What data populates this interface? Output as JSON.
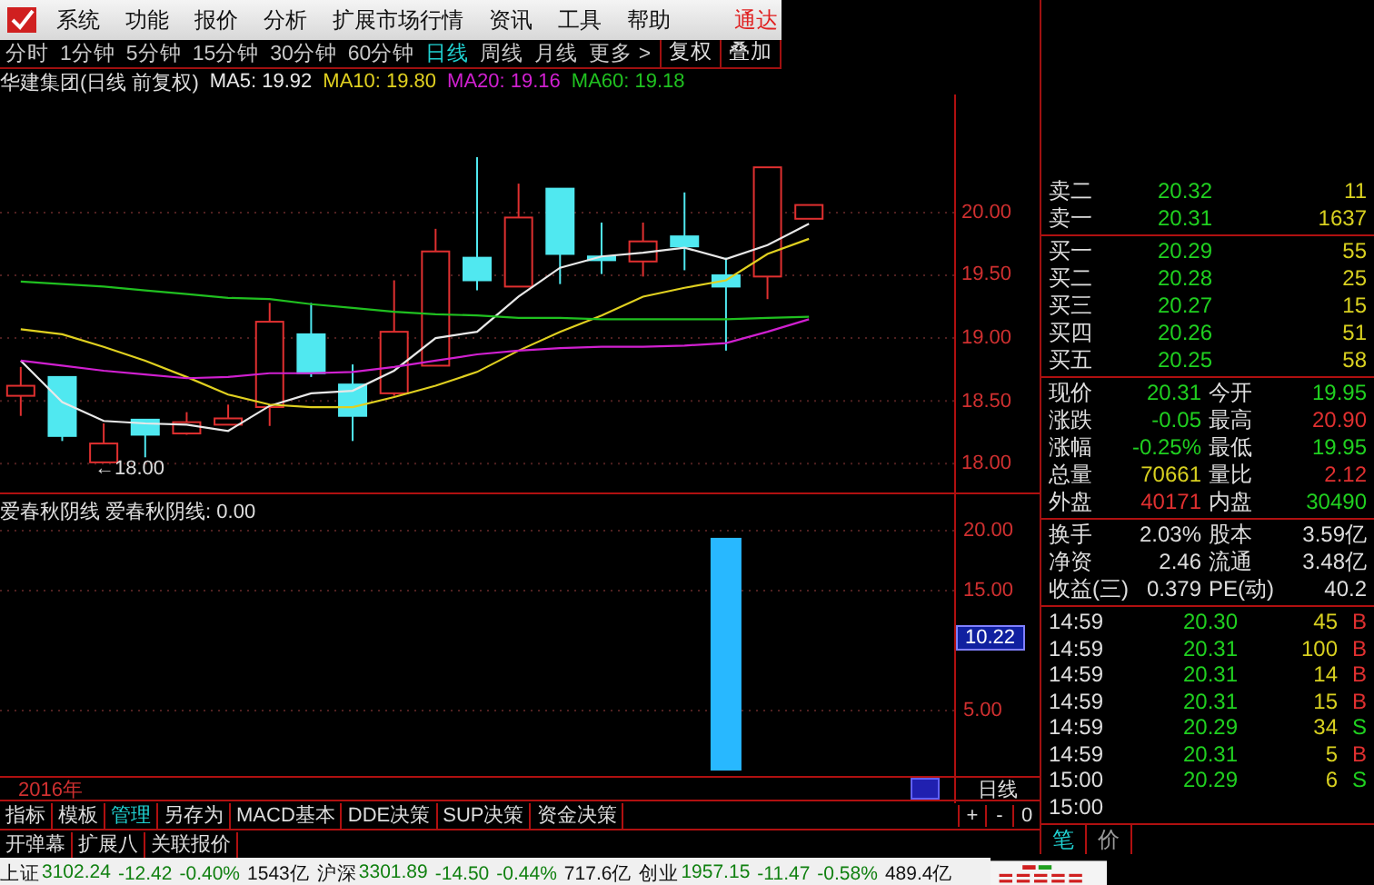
{
  "menu": {
    "items": [
      {
        "label": "系统"
      },
      {
        "label": "功能"
      },
      {
        "label": "报价"
      },
      {
        "label": "分析"
      },
      {
        "label": "扩展市场行情"
      },
      {
        "label": "资讯"
      },
      {
        "label": "工具"
      },
      {
        "label": "帮助"
      }
    ],
    "brand": "通达"
  },
  "periods": {
    "tabs": [
      {
        "label": "分时",
        "selected": false
      },
      {
        "label": "1分钟",
        "selected": false
      },
      {
        "label": "5分钟",
        "selected": false
      },
      {
        "label": "15分钟",
        "selected": false
      },
      {
        "label": "30分钟",
        "selected": false
      },
      {
        "label": "60分钟",
        "selected": false
      },
      {
        "label": "日线",
        "selected": true
      },
      {
        "label": "周线",
        "selected": false
      },
      {
        "label": "月线",
        "selected": false
      },
      {
        "label": "更多 >",
        "selected": false
      }
    ],
    "buttons": [
      "复权",
      "叠加"
    ]
  },
  "main_chart": {
    "title": "华建集团(日线 前复权)",
    "indicators": [
      {
        "label": "MA5: 19.92",
        "color": "#e8e8e8"
      },
      {
        "label": "MA10: 19.80",
        "color": "#e0d020"
      },
      {
        "label": "MA20: 19.16",
        "color": "#d020d0"
      },
      {
        "label": "MA60: 19.18",
        "color": "#20c020"
      }
    ],
    "low_marker": "←18.00",
    "chart_data": {
      "type": "candlestick",
      "grid": true,
      "categories": [
        null,
        null,
        null,
        null,
        null,
        null,
        null,
        null,
        null,
        null,
        null,
        null,
        null,
        null,
        null,
        null,
        null,
        null,
        null,
        null,
        null,
        null,
        null
      ],
      "ylim": [
        17.77,
        20.94
      ],
      "ohlc": [
        [
          18.54,
          18.77,
          18.38,
          18.62
        ],
        [
          18.69,
          18.69,
          18.18,
          18.22
        ],
        [
          18.01,
          18.32,
          18.01,
          18.16
        ],
        [
          18.35,
          18.35,
          18.05,
          18.23
        ],
        [
          18.24,
          18.41,
          18.23,
          18.33
        ],
        [
          18.31,
          18.47,
          18.31,
          18.36
        ],
        [
          18.45,
          19.28,
          18.3,
          19.13
        ],
        [
          19.03,
          19.28,
          18.69,
          18.72
        ],
        [
          18.63,
          18.79,
          18.18,
          18.38
        ],
        [
          18.56,
          19.46,
          18.54,
          19.05
        ],
        [
          18.78,
          19.87,
          18.78,
          19.69
        ],
        [
          19.64,
          20.44,
          19.38,
          19.46
        ],
        [
          19.41,
          20.23,
          19.41,
          19.96
        ],
        [
          20.19,
          20.19,
          19.43,
          19.67
        ],
        [
          19.65,
          19.92,
          19.51,
          19.62
        ],
        [
          19.61,
          19.92,
          19.49,
          19.77
        ],
        [
          19.81,
          20.16,
          19.54,
          19.73
        ],
        [
          19.5,
          19.64,
          18.9,
          19.41
        ],
        [
          19.49,
          20.36,
          19.31,
          20.36
        ],
        [
          19.95,
          20.06,
          19.95,
          20.06
        ],
        null,
        null,
        null
      ],
      "yticks": [
        {
          "value": 20,
          "label": "20.00"
        },
        {
          "value": 19.5,
          "label": "19.50"
        },
        {
          "value": 19,
          "label": "19.00"
        },
        {
          "value": 18.5,
          "label": "18.50"
        },
        {
          "value": 18,
          "label": "18.00"
        }
      ],
      "series": [
        {
          "type": "line",
          "color": "#e8e8e8",
          "values": [
            18.82,
            18.49,
            18.34,
            18.32,
            18.31,
            18.26,
            18.46,
            18.56,
            18.58,
            18.74,
            19.0,
            19.05,
            19.33,
            19.56,
            19.65,
            19.68,
            19.72,
            19.63,
            19.74,
            19.91,
            null,
            null,
            null
          ]
        },
        {
          "type": "line",
          "color": "#e0d020",
          "values": [
            19.07,
            19.03,
            18.93,
            18.82,
            18.69,
            18.55,
            18.47,
            18.45,
            18.45,
            18.53,
            18.62,
            18.73,
            18.9,
            19.05,
            19.18,
            19.33,
            19.4,
            19.46,
            19.67,
            19.79,
            null,
            null,
            null
          ]
        },
        {
          "type": "line",
          "color": "#d020d0",
          "values": [
            18.82,
            18.78,
            18.74,
            18.71,
            18.68,
            18.69,
            18.72,
            18.72,
            18.73,
            18.77,
            18.82,
            18.87,
            18.9,
            18.92,
            18.93,
            18.93,
            18.94,
            18.96,
            19.05,
            19.15,
            null,
            null,
            null
          ]
        },
        {
          "type": "line",
          "color": "#20c020",
          "values": [
            19.45,
            19.43,
            19.41,
            19.38,
            19.35,
            19.32,
            19.31,
            19.27,
            19.24,
            19.21,
            19.19,
            19.18,
            19.16,
            19.16,
            19.15,
            19.15,
            19.15,
            19.15,
            19.16,
            19.17,
            null,
            null,
            null
          ]
        }
      ]
    }
  },
  "sub_chart": {
    "title": "爱春秋阴线 爱春秋阴线: 0.00",
    "current_value": "10.22",
    "chart_data": {
      "type": "bar",
      "grid": true,
      "categories": [
        null,
        null,
        null,
        null,
        null,
        null,
        null,
        null,
        null,
        null,
        null,
        null,
        null,
        null,
        null,
        null,
        null,
        null,
        null,
        null,
        null,
        null,
        null
      ],
      "ylim": [
        -0.45,
        23.03
      ],
      "yticks": [
        {
          "value": 20,
          "label": "20.00"
        },
        {
          "value": 15,
          "label": "15.00"
        },
        {
          "value": 5,
          "label": "5.00"
        }
      ],
      "values": [
        null,
        null,
        null,
        null,
        null,
        null,
        null,
        null,
        null,
        null,
        null,
        null,
        null,
        null,
        null,
        null,
        null,
        19.4,
        null,
        null,
        null,
        null,
        null
      ]
    }
  },
  "timeline": {
    "year": "2016年",
    "period": "日线"
  },
  "bottom_tabs": {
    "tabs": [
      {
        "label": "指标",
        "selected": false
      },
      {
        "label": "模板",
        "selected": false
      },
      {
        "label": "管理",
        "selected": true
      },
      {
        "label": "另存为",
        "selected": false
      },
      {
        "label": "MACD基本",
        "selected": false
      },
      {
        "label": "DDE决策",
        "selected": false
      },
      {
        "label": "SUP决策",
        "selected": false
      },
      {
        "label": "资金决策",
        "selected": false
      }
    ],
    "zoom_buttons": [
      "+",
      "-",
      "0"
    ]
  },
  "extra_tabs": [
    "开弹幕",
    "扩展八",
    "关联报价"
  ],
  "order_book": {
    "asks": [
      {
        "label": "卖二",
        "price": "20.32",
        "volume": "11"
      },
      {
        "label": "卖一",
        "price": "20.31",
        "volume": "1637"
      }
    ],
    "bids": [
      {
        "label": "买一",
        "price": "20.29",
        "volume": "55"
      },
      {
        "label": "买二",
        "price": "20.28",
        "volume": "25"
      },
      {
        "label": "买三",
        "price": "20.27",
        "volume": "15"
      },
      {
        "label": "买四",
        "price": "20.26",
        "volume": "51"
      },
      {
        "label": "买五",
        "price": "20.25",
        "volume": "58"
      }
    ]
  },
  "quote_stats": [
    {
      "label": "现价",
      "value": "20.31",
      "color": "#20d020"
    },
    {
      "label": "今开",
      "value": "19.95",
      "color": "#20d020"
    },
    {
      "label": "涨跌",
      "value": "-0.05",
      "color": "#20d020"
    },
    {
      "label": "最高",
      "value": "20.90",
      "color": "#e03030"
    },
    {
      "label": "涨幅",
      "value": "-0.25%",
      "color": "#20d020"
    },
    {
      "label": "最低",
      "value": "19.95",
      "color": "#20d020"
    },
    {
      "label": "总量",
      "value": "70661",
      "color": "#d8d020"
    },
    {
      "label": "量比",
      "value": "2.12",
      "color": "#e03030"
    },
    {
      "label": "外盘",
      "value": "40171",
      "color": "#e03030"
    },
    {
      "label": "内盘",
      "value": "30490",
      "color": "#20d020"
    }
  ],
  "fundamentals": [
    {
      "label": "换手",
      "value": "2.03%"
    },
    {
      "label": "股本",
      "value": "3.59亿"
    },
    {
      "label": "净资",
      "value": "2.46"
    },
    {
      "label": "流通",
      "value": "3.48亿"
    },
    {
      "label": "收益(三)",
      "value": "0.379"
    },
    {
      "label": "PE(动)",
      "value": "40.2"
    }
  ],
  "trades": [
    {
      "time": "14:59",
      "price": "20.30",
      "volume": "45",
      "side": "B",
      "color": "#e03030"
    },
    {
      "time": "14:59",
      "price": "20.31",
      "volume": "100",
      "side": "B",
      "color": "#e03030"
    },
    {
      "time": "14:59",
      "price": "20.31",
      "volume": "14",
      "side": "B",
      "color": "#e03030"
    },
    {
      "time": "14:59",
      "price": "20.31",
      "volume": "15",
      "side": "B",
      "color": "#e03030"
    },
    {
      "time": "14:59",
      "price": "20.29",
      "volume": "34",
      "side": "S",
      "color": "#20d020"
    },
    {
      "time": "14:59",
      "price": "20.31",
      "volume": "5",
      "side": "B",
      "color": "#e03030"
    },
    {
      "time": "15:00",
      "price": "20.29",
      "volume": "6",
      "side": "S",
      "color": "#20d020"
    },
    {
      "time": "15:00"
    }
  ],
  "panel_tabs": [
    {
      "label": "笔",
      "selected": true
    },
    {
      "label": "价",
      "selected": false
    }
  ],
  "status_bar": [
    {
      "name": "上证",
      "value": "3102.24",
      "change": "-12.42",
      "percent": "-0.40%",
      "amount": "1543亿"
    },
    {
      "name": "沪深",
      "value": "3301.89",
      "change": "-14.50",
      "percent": "-0.44%",
      "amount": "717.6亿"
    },
    {
      "name": "创业",
      "value": "1957.15",
      "change": "-11.47",
      "percent": "-0.58%",
      "amount": "489.4亿"
    }
  ]
}
